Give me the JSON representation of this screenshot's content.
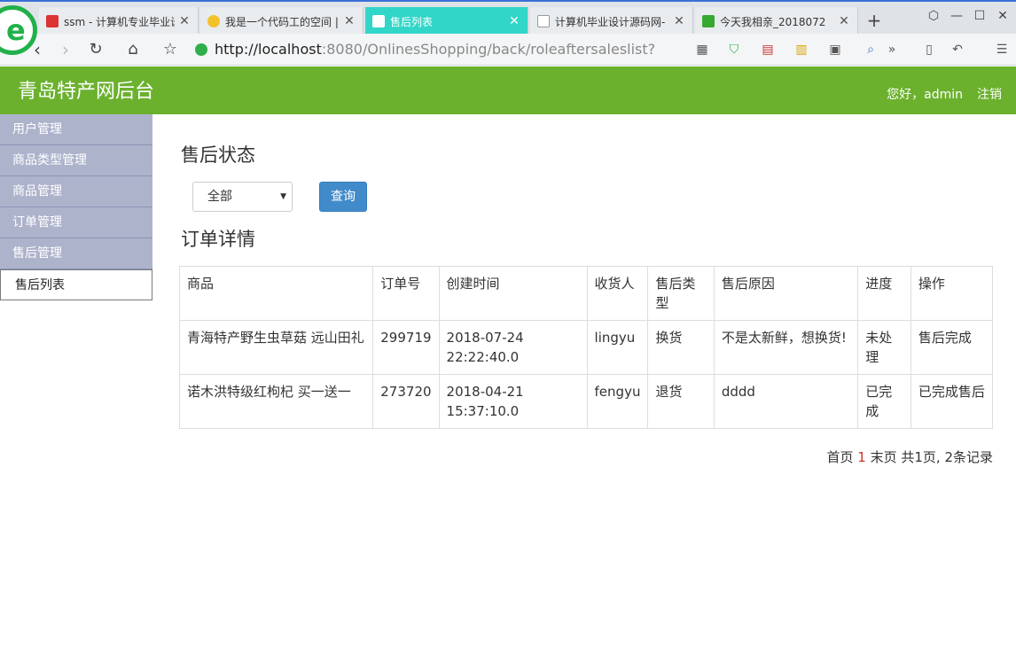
{
  "browser": {
    "tabs": [
      {
        "title": "ssm - 计算机专业毕业设",
        "active": false,
        "icon": "red-flag-icon"
      },
      {
        "title": "我是一个代码工的空间 |",
        "active": false,
        "icon": "star-icon"
      },
      {
        "title": "售后列表",
        "active": true,
        "icon": "page-icon"
      },
      {
        "title": "计算机毕业设计源码网-",
        "active": false,
        "icon": "page-icon"
      },
      {
        "title": "今天我相亲_2018072",
        "active": false,
        "icon": "green-icon"
      }
    ],
    "newtab_label": "+",
    "url_host": "http://localhost",
    "url_path": ":8080/OnlinesShopping/back/roleaftersaleslist?"
  },
  "header": {
    "title": "青岛特产网后台",
    "greeting": "您好，admin",
    "logout": "注销"
  },
  "sidebar": {
    "items": [
      {
        "label": "用户管理"
      },
      {
        "label": "商品类型管理"
      },
      {
        "label": "商品管理"
      },
      {
        "label": "订单管理"
      },
      {
        "label": "售后管理"
      }
    ],
    "sub_item": "售后列表"
  },
  "main": {
    "status_heading": "售后状态",
    "status_select_value": "全部",
    "query_button": "查询",
    "order_heading": "订单详情",
    "columns": [
      "商品",
      "订单号",
      "创建时间",
      "收货人",
      "售后类型",
      "售后原因",
      "进度",
      "操作"
    ],
    "rows": [
      [
        "青海特产野生虫草菇 远山田礼",
        "299719",
        "2018-07-24 22:22:40.0",
        "lingyu",
        "换货",
        "不是太新鲜，想换货!",
        "未处理",
        "售后完成"
      ],
      [
        "诺木洪特级红枸杞 买一送一",
        "273720",
        "2018-04-21 15:37:10.0",
        "fengyu",
        "退货",
        "dddd",
        "已完成",
        "已完成售后"
      ]
    ],
    "pager": {
      "first": "首页",
      "current": "1",
      "last": "末页",
      "summary": "共1页, 2条记录"
    }
  },
  "colors": {
    "header_green": "#6bb12e",
    "sidebar_bg": "#aeb3cc",
    "active_tab": "#31d6c8",
    "button_blue": "#428bca"
  }
}
